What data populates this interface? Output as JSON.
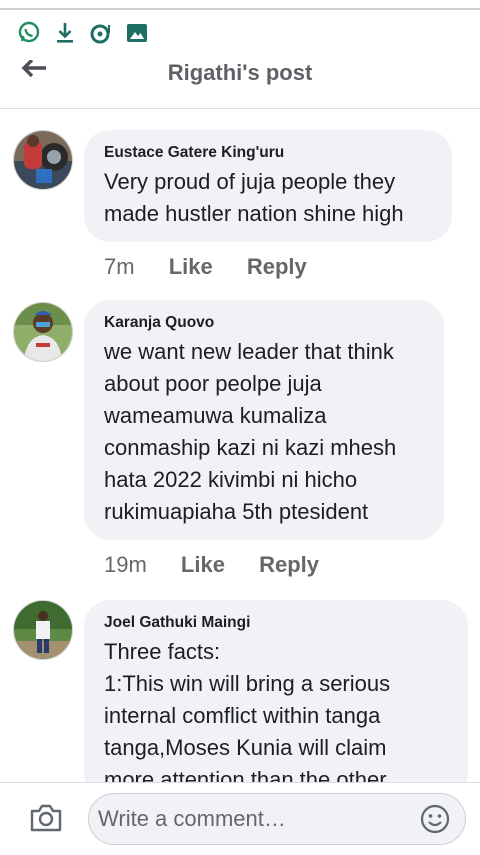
{
  "status_bar": {
    "icons": [
      "whatsapp-icon",
      "download-icon",
      "data-saver-icon",
      "image-icon"
    ]
  },
  "header": {
    "back_icon": "arrow-left-icon",
    "title": "Rigathi's post"
  },
  "comments": [
    {
      "author": "Eustace Gatere King'uru",
      "text": "Very proud of juja people they\nmade hustler nation shine high",
      "time": "7m",
      "like": "Like",
      "reply": "Reply"
    },
    {
      "author": "Karanja Quovo",
      "text": "we want new leader that think\nabout poor peolpe juja\nwameamuwa kumaliza\nconmaship kazi ni kazi mhesh\nhata 2022 kivimbi ni hicho\nrukimuapiaha 5th ptesident",
      "time": "19m",
      "like": "Like",
      "reply": "Reply"
    },
    {
      "author": "Joel Gathuki Maingi",
      "text": "Three facts:\n1:This win will bring a serious\ninternal comflict within tanga\ntanga,Moses Kunia will claim\nmore attention than the other"
    }
  ],
  "composer": {
    "camera_icon": "camera-icon",
    "placeholder": "Write a comment…",
    "emoji_icon": "smiley-icon"
  },
  "colors": {
    "bubble": "#f0f2f5",
    "meta_text": "#65676b",
    "title_text": "#5e6166",
    "whatsapp_green": "#1f8f5f",
    "status_icon": "#1f6e63"
  }
}
